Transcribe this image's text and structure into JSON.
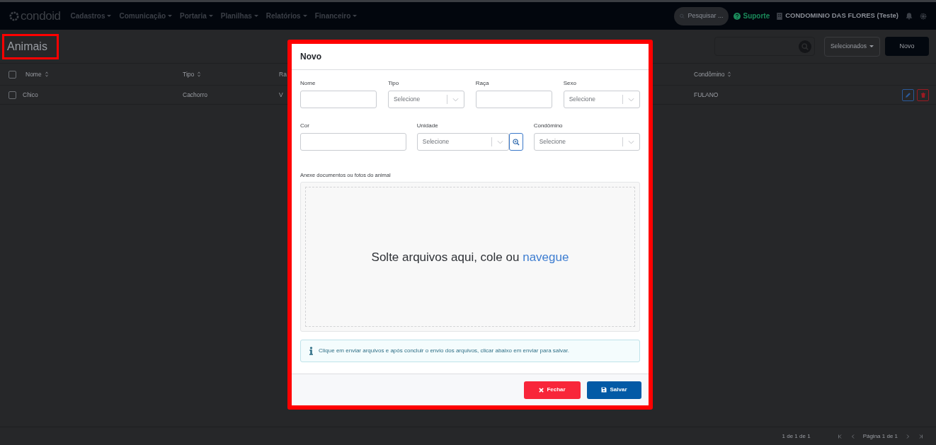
{
  "navbar": {
    "logo": "condoid",
    "menus": [
      {
        "label": "Cadastros"
      },
      {
        "label": "Comunicação"
      },
      {
        "label": "Portaria"
      },
      {
        "label": "Planilhas"
      },
      {
        "label": "Relatórios"
      },
      {
        "label": "Financeiro"
      }
    ],
    "search": {
      "placeholder": "Pesquisar ..."
    },
    "support": "Suporte",
    "condo": "CONDOMINIO DAS FLORES (Teste)"
  },
  "page": {
    "title": "Animais",
    "selected_button": "Selecionados",
    "new_button": "Novo"
  },
  "table": {
    "select_all": {
      "checked": false
    },
    "columns": [
      {
        "label": "Nome"
      },
      {
        "label": "Tipo"
      },
      {
        "label": "Ra"
      },
      {
        "label": "Condômino"
      }
    ],
    "rows": [
      {
        "checked": false,
        "cells": [
          "Chico",
          "Cachorro",
          "V",
          "FULANO"
        ]
      }
    ]
  },
  "pagination": {
    "count": "1 de 1 de 1",
    "page": "Página 1 de 1"
  },
  "modal": {
    "title": "Novo",
    "rows": [
      [
        {
          "kind": "text",
          "label": "Nome"
        },
        {
          "kind": "select",
          "label": "Tipo",
          "placeholder": "Selecione"
        },
        {
          "kind": "text",
          "label": "Raça"
        },
        {
          "kind": "select",
          "label": "Sexo",
          "placeholder": "Selecione"
        }
      ],
      [
        {
          "kind": "text",
          "label": "Cor"
        },
        {
          "kind": "select",
          "label": "Unidade",
          "placeholder": "Selecione",
          "lookup": true
        },
        {
          "kind": "select",
          "label": "Condômino",
          "placeholder": "Selecione"
        }
      ]
    ],
    "upload": {
      "label": "Anexe documentos ou fotos do animal",
      "text": "Solte arquivos aqui, cole ou",
      "link": "navegue"
    },
    "info": "Clique em enviar arquivos e após concluir o envio dos arquivos, clicar abaixo em enviar para salvar.",
    "buttons": [
      {
        "kind": "danger",
        "label": "Fechar"
      },
      {
        "kind": "primary",
        "label": "Salvar"
      }
    ]
  }
}
